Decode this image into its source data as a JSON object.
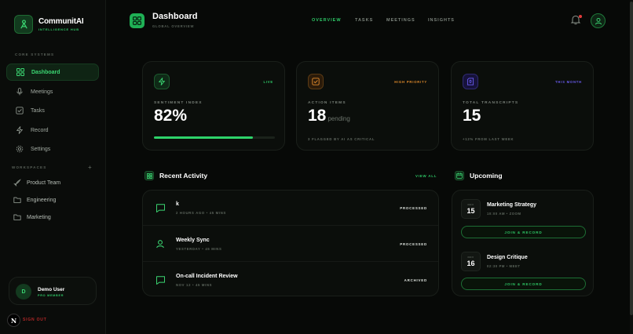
{
  "brand": {
    "name": "CommunitAI",
    "tagline": "INTELLIGENCE HUB"
  },
  "sidebar": {
    "section_core": "CORE SYSTEMS",
    "items": [
      {
        "label": "Dashboard",
        "icon": "grid-icon",
        "active": true
      },
      {
        "label": "Meetings",
        "icon": "mic-icon"
      },
      {
        "label": "Tasks",
        "icon": "checkbox-icon"
      },
      {
        "label": "Record",
        "icon": "bolt-icon"
      },
      {
        "label": "Settings",
        "icon": "gear-icon"
      }
    ],
    "section_workspaces": "WORKSPACES",
    "add_symbol": "+",
    "workspaces": [
      {
        "label": "Product Team",
        "icon": "rocket-icon"
      },
      {
        "label": "Engineering",
        "icon": "folder-icon"
      },
      {
        "label": "Marketing",
        "icon": "folder-icon"
      }
    ],
    "user": {
      "initial": "D",
      "name": "Demo User",
      "role": "PRO MEMBER"
    },
    "n_badge": "N",
    "signout": "SIGN OUT"
  },
  "header": {
    "title": "Dashboard",
    "subtitle": "GLOBAL OVERVIEW",
    "tabs": [
      {
        "label": "OVERVIEW",
        "active": true
      },
      {
        "label": "TASKS"
      },
      {
        "label": "MEETINGS"
      },
      {
        "label": "INSIGHTS"
      }
    ]
  },
  "stats": [
    {
      "tag": "LIVE",
      "tag_color": "#2ec766",
      "label": "SENTIMENT INDEX",
      "value": "82%",
      "suffix": "",
      "progress": 0.82,
      "icon": "bolt-icon"
    },
    {
      "tag": "HIGH PRIORITY",
      "tag_color": "#e08a2c",
      "label": "ACTION ITEMS",
      "value": "18",
      "suffix": "pending",
      "foot": "3 FLAGGED BY AI AS CRITICAL",
      "icon": "checkbox-icon"
    },
    {
      "tag": "THIS MONTH",
      "tag_color": "#6a5cf0",
      "label": "TOTAL TRANSCRIPTS",
      "value": "15",
      "suffix": "",
      "foot": "+12% FROM LAST WEEK",
      "icon": "doc-mic-icon"
    }
  ],
  "activity": {
    "title": "Recent Activity",
    "view_all": "VIEW ALL",
    "items": [
      {
        "title": "k",
        "meta": "2 HOURS AGO • 45 MINS",
        "status": "PROCESSED",
        "icon": "chat-icon"
      },
      {
        "title": "Weekly Sync",
        "meta": "YESTERDAY • 45 MINS",
        "status": "PROCESSED",
        "icon": "user-icon"
      },
      {
        "title": "On-call Incident Review",
        "meta": "NOV 12 • 45 MINS",
        "status": "ARCHIVED",
        "icon": "chat-icon"
      }
    ]
  },
  "upcoming": {
    "title": "Upcoming",
    "items": [
      {
        "month": "NOV",
        "day": "15",
        "title": "Marketing Strategy",
        "meta": "10:00 AM • ZOOM",
        "button": "JOIN & RECORD"
      },
      {
        "month": "NOV",
        "day": "16",
        "title": "Design Critique",
        "meta": "02:30 PM • MEET",
        "button": "JOIN & RECORD"
      }
    ]
  }
}
